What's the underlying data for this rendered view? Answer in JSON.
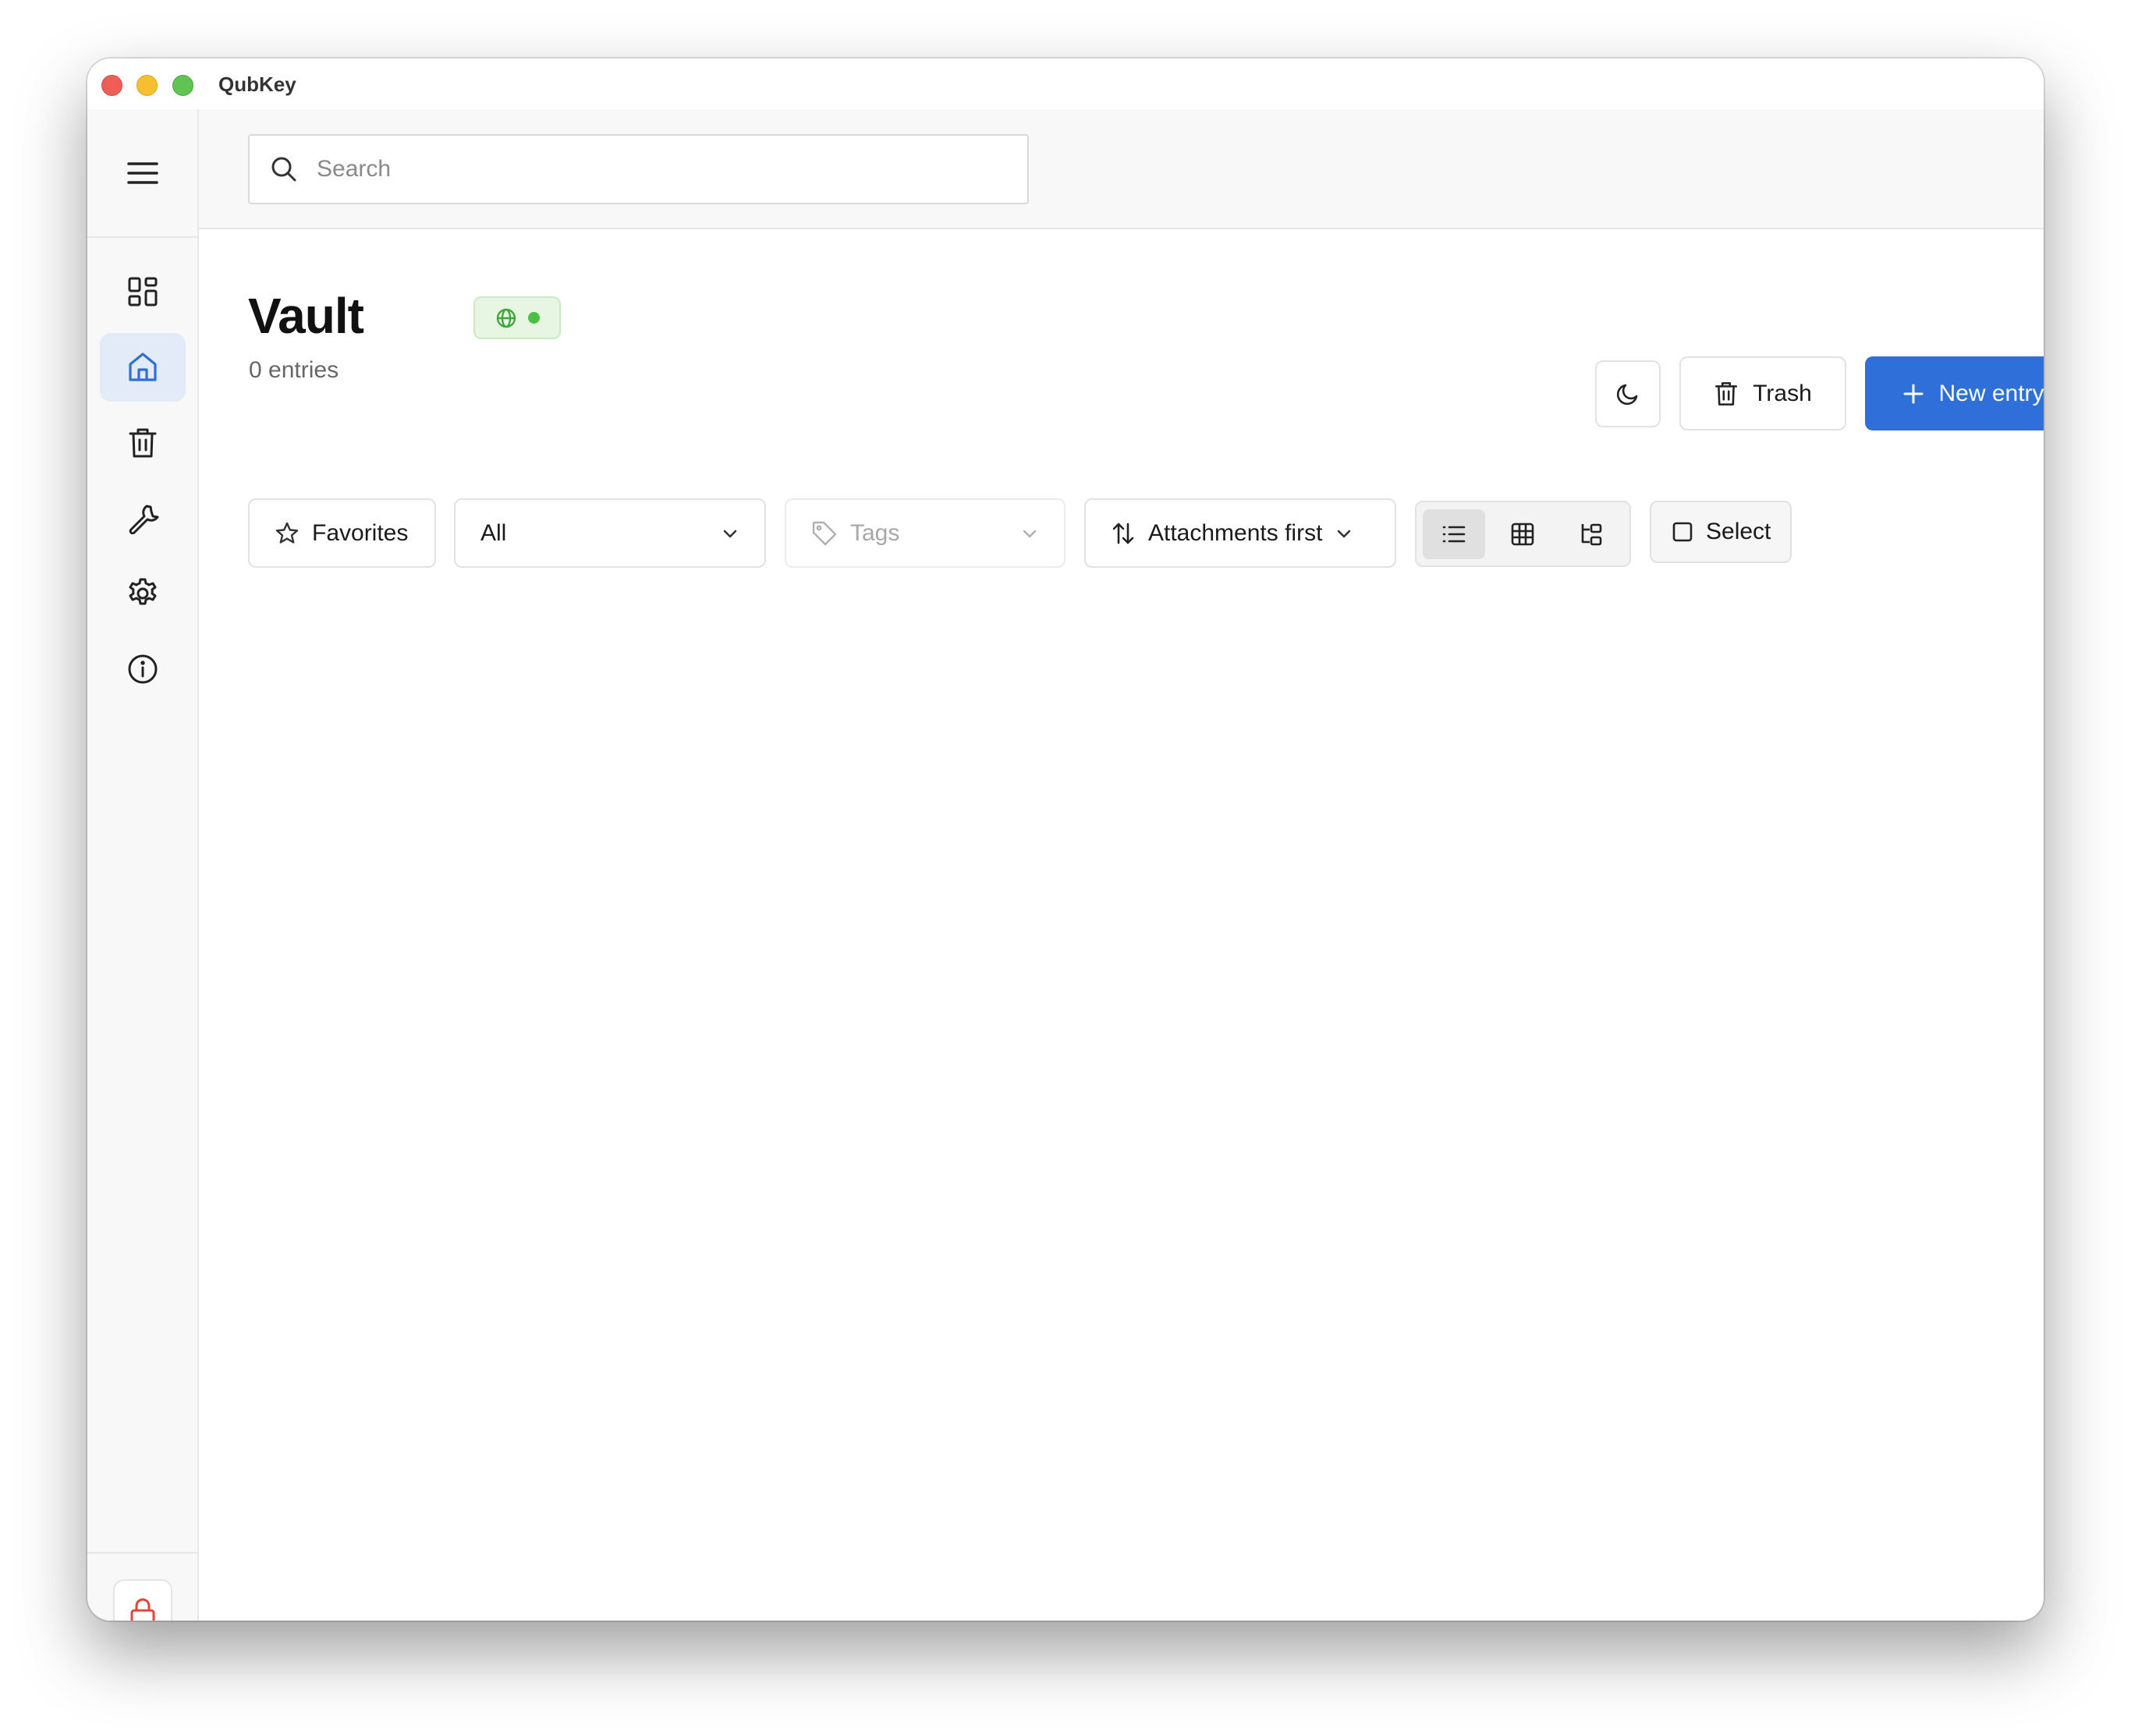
{
  "window": {
    "title": "QubKey"
  },
  "sidebar": {
    "menu_icon": "hamburger-menu-icon",
    "items": [
      {
        "id": "dashboard",
        "icon": "dashboard-grid-icon",
        "active": false
      },
      {
        "id": "vault",
        "icon": "home-icon",
        "active": true
      },
      {
        "id": "trash",
        "icon": "trash-icon",
        "active": false
      },
      {
        "id": "tools",
        "icon": "wrench-icon",
        "active": false
      },
      {
        "id": "settings",
        "icon": "gear-icon",
        "active": false
      },
      {
        "id": "about",
        "icon": "info-icon",
        "active": false
      }
    ],
    "lock_icon": "lock-icon"
  },
  "search": {
    "placeholder": "Search",
    "value": ""
  },
  "header": {
    "title": "Vault",
    "entries_count": "0 entries",
    "status_badge": {
      "icon": "globe-icon",
      "status": "online"
    }
  },
  "actions": {
    "theme_toggle_icon": "moon-icon",
    "trash_label": "Trash",
    "new_entry_label": "New entry"
  },
  "filters": {
    "favorites_label": "Favorites",
    "type_selected": "All",
    "tags_placeholder": "Tags",
    "sort_label": "Attachments first",
    "select_label": "Select"
  },
  "view_modes": [
    {
      "id": "list",
      "icon": "list-icon",
      "active": true
    },
    {
      "id": "grid",
      "icon": "grid-icon",
      "active": false
    },
    {
      "id": "tree",
      "icon": "tree-icon",
      "active": false
    }
  ],
  "colors": {
    "accent": "#2f6fd9",
    "sidebar_active_bg": "#e3ebf8",
    "status_green": "#4cbf46",
    "lock_red": "#e0443a"
  }
}
